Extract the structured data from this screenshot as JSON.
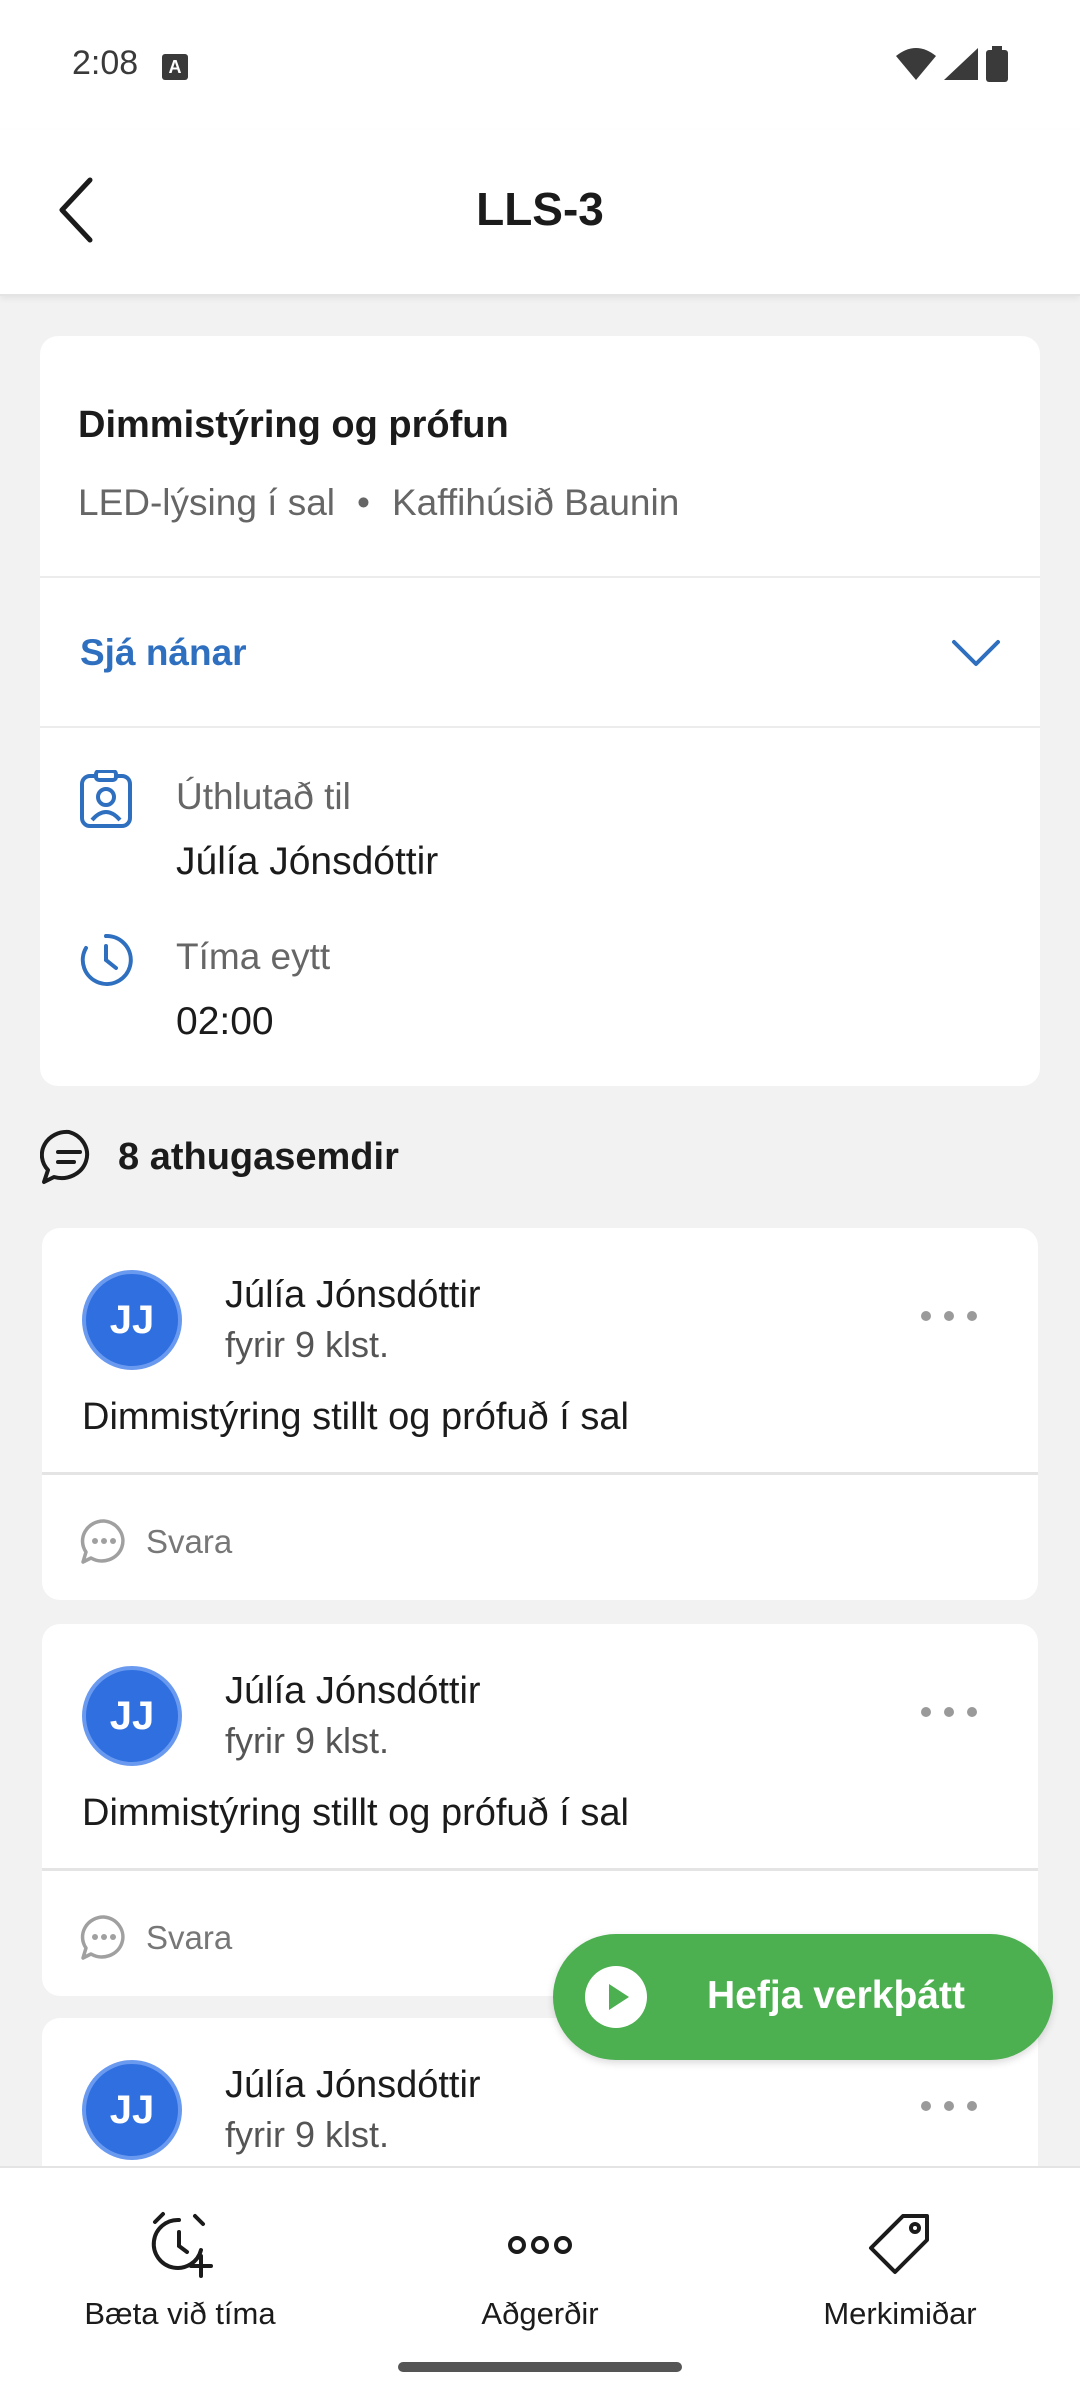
{
  "status_bar": {
    "time": "2:08",
    "notification_icon": "A"
  },
  "header": {
    "title": "LLS-3",
    "back_icon": "chevron-left-icon"
  },
  "task": {
    "title": "Dimmistýring og prófun",
    "subtitle_location": "LED-lýsing í sal",
    "subtitle_separator": "•",
    "subtitle_client": "Kaffihúsið Baunin",
    "see_more_label": "Sjá nánar",
    "assigned_label": "Úthlutað til",
    "assigned_value": "Júlía Jónsdóttir",
    "time_label": "Tíma eytt",
    "time_value": "02:00"
  },
  "comments": {
    "title": "8 athugasemdir",
    "items": [
      {
        "initials": "JJ",
        "author": "Júlía Jónsdóttir",
        "time": "fyrir 9 klst.",
        "text": "Dimmistýring stillt og prófuð í sal",
        "reply_label": "Svara"
      },
      {
        "initials": "JJ",
        "author": "Júlía Jónsdóttir",
        "time": "fyrir 9 klst.",
        "text": "Dimmistýring stillt og prófuð í sal",
        "reply_label": "Svara"
      },
      {
        "initials": "JJ",
        "author": "Júlía Jónsdóttir",
        "time": "fyrir 9 klst.",
        "text": "",
        "reply_label": ""
      }
    ]
  },
  "fab": {
    "label": "Hefja verkþátt",
    "icon": "play-icon"
  },
  "bottom_nav": {
    "items": [
      {
        "label": "Bæta við tíma",
        "icon": "add-alarm-icon"
      },
      {
        "label": "Aðgerðir",
        "icon": "more-horizontal-icon"
      },
      {
        "label": "Merkimiðar",
        "icon": "tag-icon"
      }
    ]
  },
  "colors": {
    "accent_blue": "#2f6fbf",
    "avatar_blue": "#2f6fe0",
    "fab_green": "#4caf50",
    "background": "#f2f2f2"
  }
}
